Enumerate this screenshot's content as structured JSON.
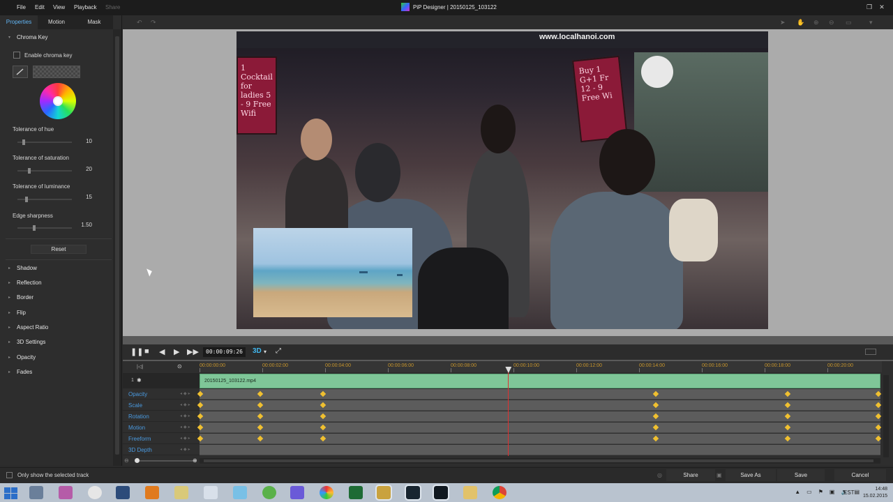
{
  "window": {
    "title": "PiP Designer | 20150125_103122",
    "menu": [
      "File",
      "Edit",
      "View",
      "Playback",
      "Share"
    ]
  },
  "left_panel": {
    "tabs": [
      "Properties",
      "Motion",
      "Mask"
    ],
    "active_tab": "Properties",
    "chroma_key": {
      "title": "Chroma Key",
      "enable_label": "Enable chroma key",
      "enabled": false,
      "sliders": [
        {
          "label": "Tolerance of hue",
          "value": "10",
          "fraction": 0.09
        },
        {
          "label": "Tolerance of saturation",
          "value": "20",
          "fraction": 0.2
        },
        {
          "label": "Tolerance of luminance",
          "value": "15",
          "fraction": 0.15
        },
        {
          "label": "Edge sharpness",
          "value": "1.50",
          "fraction": 0.3
        }
      ],
      "reset_label": "Reset"
    },
    "sections": [
      "Shadow",
      "Reflection",
      "Border",
      "Flip",
      "Aspect Ratio",
      "3D Settings",
      "Opacity",
      "Fades"
    ]
  },
  "preview": {
    "video_url_text": "www.localhanoi.com",
    "boards": [
      "Buy 1 G+1 Fr 12 - 9 Free Wi",
      "1 Cocktail for ladies 5 - 9 Free Wifi"
    ],
    "scrub_position": 0.43
  },
  "playback": {
    "timecode": "00:00:09:26",
    "mode_3d": "3D"
  },
  "timeline": {
    "ruler_labels": [
      "00:00:00:00",
      "00:00:02:00",
      "00:00:04:00",
      "00:00:06:00",
      "00:00:08:00",
      "00:00:10:00",
      "00:00:12:00",
      "00:00:14:00",
      "00:00:16:00",
      "00:00:18:00",
      "00:00:20:00"
    ],
    "track_number": "1",
    "clip_name": "20150125_103122.mp4",
    "keyframe_tracks": [
      {
        "name": "Opacity",
        "has_keyframes": true
      },
      {
        "name": "Scale",
        "has_keyframes": true
      },
      {
        "name": "Rotation",
        "has_keyframes": true
      },
      {
        "name": "Motion",
        "has_keyframes": true
      },
      {
        "name": "Freeform",
        "has_keyframes": true
      },
      {
        "name": "3D Depth",
        "has_keyframes": false
      }
    ],
    "keyframe_times_sec": [
      0,
      1.9,
      3.9,
      14.5,
      18.7,
      21.8
    ],
    "playhead_sec": 9.83
  },
  "bottom_bar": {
    "only_selected_label": "Only show the selected track",
    "share_label": "Share",
    "save_as_label": "Save As",
    "save_label": "Save",
    "cancel_label": "Cancel"
  },
  "taskbar": {
    "language": "EST",
    "time": "14:48",
    "date": "15.02.2015"
  }
}
